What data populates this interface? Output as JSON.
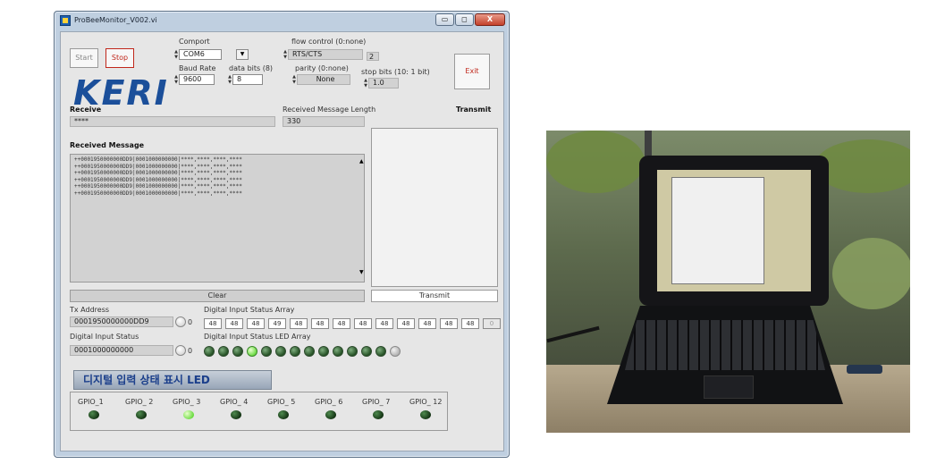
{
  "window": {
    "title": "ProBeeMonitor_V002.vi",
    "min_glyph": "▭",
    "max_glyph": "◻",
    "close_glyph": "X"
  },
  "buttons": {
    "start": "Start",
    "stop": "Stop",
    "exit": "Exit",
    "clear": "Clear",
    "transmit": "Transmit"
  },
  "logo": {
    "text": "KERI",
    "color": "#1b4f9a"
  },
  "serial": {
    "comport_label": "Comport",
    "comport_value": "COM6",
    "baud_label": "Baud Rate",
    "baud_value": "9600",
    "databits_label": "data bits (8)",
    "databits_value": "8",
    "flow_label": "flow control (0:none)",
    "flow_value": "RTS/CTS",
    "flow_extra": "2",
    "parity_label": "parity (0:none)",
    "parity_value": "None",
    "stopbits_label": "stop bits (10: 1 bit)",
    "stopbits_value": "1.0"
  },
  "receive": {
    "label": "Receive",
    "value": "****",
    "length_label": "Received Message Length",
    "length_value": "330",
    "transmit_label": "Transmit",
    "message_label": "Received Message",
    "lines": [
      "++0001950000000DD9|0001000000000|****,****,****,****",
      "++0001950000000DD9|0001000000000|****,****,****,****",
      "++0001950000000DD9|0001000000000|****,****,****,****",
      "++0001950000000DD9|0001000000000|****,****,****,****",
      "++0001950000000DD9|0001000000000|****,****,****,****",
      "++0001950000000DD9|0001000000000|****,****,****,****"
    ]
  },
  "tx": {
    "address_label": "Tx Address",
    "address_value": "0001950000000DD9",
    "knob_value": "0"
  },
  "dinput": {
    "status_label": "Digital Input Status",
    "status_value": "0001000000000",
    "knob_value": "0"
  },
  "array": {
    "label": "Digital Input Status Array",
    "values": [
      "48",
      "48",
      "48",
      "49",
      "48",
      "48",
      "48",
      "48",
      "48",
      "48",
      "48",
      "48",
      "48"
    ],
    "trailing": "0"
  },
  "led_array": {
    "label": "Digital Input Status LED Array",
    "states": [
      false,
      false,
      false,
      true,
      false,
      false,
      false,
      false,
      false,
      false,
      false,
      false,
      false
    ],
    "extra_off": true
  },
  "korean_title": "디지털 입력 상태 표시 LED",
  "gpio": [
    {
      "label": "GPIO_1",
      "on": false
    },
    {
      "label": "GPIO_ 2",
      "on": false
    },
    {
      "label": "GPIO_ 3",
      "on": true
    },
    {
      "label": "GPIO_ 4",
      "on": false
    },
    {
      "label": "GPIO_ 5",
      "on": false
    },
    {
      "label": "GPIO_ 6",
      "on": false
    },
    {
      "label": "GPIO_ 7",
      "on": false
    },
    {
      "label": "GPIO_ 12",
      "on": false
    }
  ],
  "colors": {
    "led_on": "#6cdb44",
    "led_off": "#245024",
    "stop_text": "#c0271b",
    "accent": "#1b4f9a"
  }
}
